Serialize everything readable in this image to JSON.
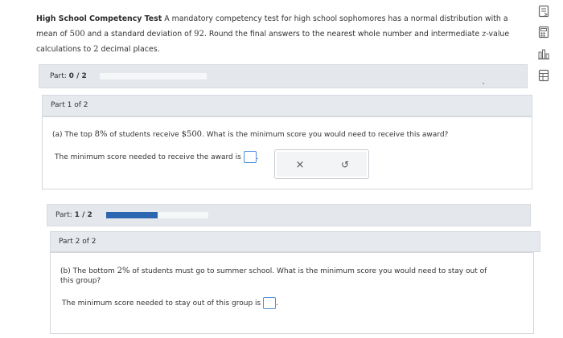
{
  "problem": {
    "title": "High School Competency Test",
    "text_1": " A mandatory competency test for high school sophomores has a normal distribution with a mean of ",
    "mean": "500",
    "text_2": " and a standard deviation of ",
    "sd": "92",
    "text_3": ". Round the final answers to the nearest whole number and intermediate ",
    "zvar": "z",
    "text_4": "-value calculations to ",
    "decimals": "2",
    "text_5": " decimal places."
  },
  "tools": {
    "icons": [
      "book-icon",
      "calculator-icon",
      "chart-icon",
      "table-icon"
    ]
  },
  "part_top": {
    "label_prefix": "Part: ",
    "label_value": "0 / 2",
    "progress": 0
  },
  "part1": {
    "tab_label": "Part 1 of 2",
    "q_prefix": "(a) The top ",
    "q_percent": "8%",
    "q_mid": " of students receive ",
    "q_amount": "$500",
    "q_suffix": ". What is the minimum score you would need to receive this award?",
    "answer_prefix": "The minimum score needed to receive the award is",
    "answer_suffix": ".",
    "clear_glyph": "×",
    "undo_glyph": "↺"
  },
  "part_mid": {
    "label_prefix": "Part: ",
    "label_value": "1 / 2",
    "progress": 0.5
  },
  "part2": {
    "tab_label": "Part 2 of 2",
    "q_prefix": "(b) The bottom ",
    "q_percent": "2%",
    "q_suffix": " of students must go to summer school. What is the minimum score you would need to stay out of this group?",
    "answer_prefix": "The minimum score needed to stay out of this group is",
    "answer_suffix": "."
  }
}
